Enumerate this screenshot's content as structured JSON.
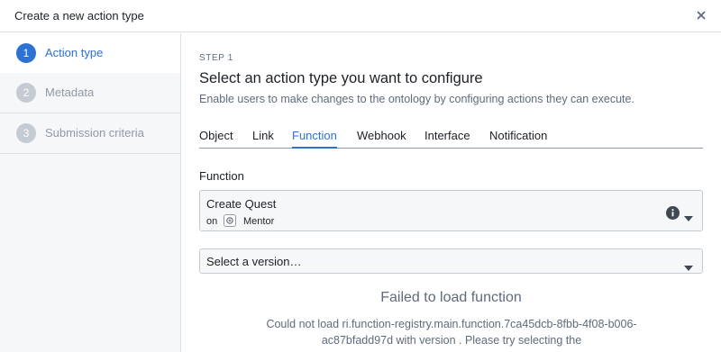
{
  "dialog": {
    "title": "Create a new action type",
    "close_icon": "close-icon"
  },
  "sidebar": {
    "steps": [
      {
        "number": "1",
        "label": "Action type",
        "active": true
      },
      {
        "number": "2",
        "label": "Metadata",
        "active": false
      },
      {
        "number": "3",
        "label": "Submission criteria",
        "active": false
      }
    ]
  },
  "main": {
    "step_kicker": "STEP 1",
    "title": "Select an action type you want to configure",
    "description": "Enable users to make changes to the ontology by configuring actions they can execute.",
    "tabs": [
      {
        "label": "Object",
        "active": false
      },
      {
        "label": "Link",
        "active": false
      },
      {
        "label": "Function",
        "active": true
      },
      {
        "label": "Webhook",
        "active": false
      },
      {
        "label": "Interface",
        "active": false
      },
      {
        "label": "Notification",
        "active": false
      }
    ],
    "function_field": {
      "label": "Function",
      "selected_name": "Create Quest",
      "on_label": "on",
      "repository": "Mentor",
      "repository_icon": "repository-icon",
      "info_icon": "info-icon"
    },
    "version_select": {
      "placeholder": "Select a version…"
    },
    "error": {
      "title": "Failed to load function",
      "message": "Could not load ri.function-registry.main.function.7ca45dcb-8fbb-4f08-b006-ac87bfadd97d with version . Please try selecting the"
    }
  },
  "colors": {
    "accent": "#2d72d2",
    "muted": "#8f99a8",
    "border": "#dce0e5"
  }
}
